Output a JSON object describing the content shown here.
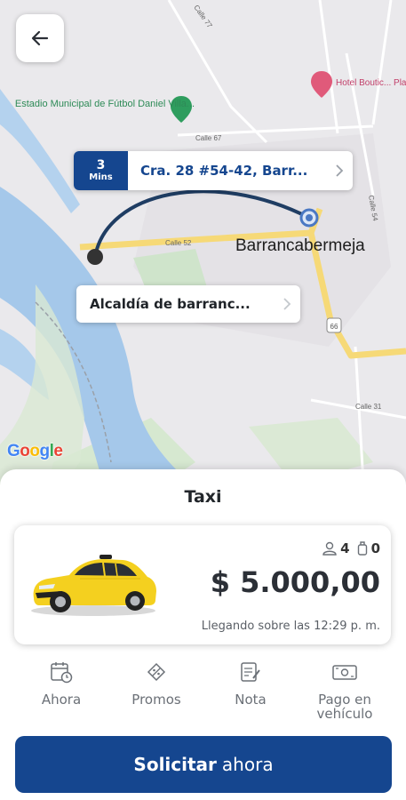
{
  "colors": {
    "brand": "#15468f",
    "map_bg": "#eae9ec",
    "water": "#a5c8ea",
    "road_major": "#f6d977",
    "park": "#cfe4cb"
  },
  "map": {
    "streets": [
      "Calle 77",
      "Calle 67",
      "Calle 52",
      "Calle 54",
      "Calle 31",
      "66"
    ],
    "pois": [
      {
        "name": "Estadio Municipal de Fútbol Daniel Villa...",
        "icon": "park-pin-icon"
      },
      {
        "name": "Hotel Boutic... Plazuela Rea...",
        "icon": "hotel-pin-icon"
      }
    ],
    "city": "Barrancabermeja",
    "attribution": "Google"
  },
  "route": {
    "eta_value": "3",
    "eta_unit": "Mins",
    "destination": "Cra. 28 #54-42, Barr...",
    "origin": "Alcaldía de barranc..."
  },
  "sheet": {
    "title": "Taxi",
    "vehicle": {
      "passengers": "4",
      "luggage": "0",
      "price": "$ 5.000,00",
      "arrival": "Llegando sobre las 12:29 p. m."
    },
    "actions": [
      {
        "label": "Ahora",
        "icon": "calendar-clock-icon"
      },
      {
        "label": "Promos",
        "icon": "coupon-icon"
      },
      {
        "label": "Nota",
        "icon": "note-icon"
      },
      {
        "label": "Pago en vehículo",
        "icon": "cash-icon"
      }
    ],
    "cta": {
      "bold": "Solicitar",
      "rest": "ahora"
    }
  }
}
